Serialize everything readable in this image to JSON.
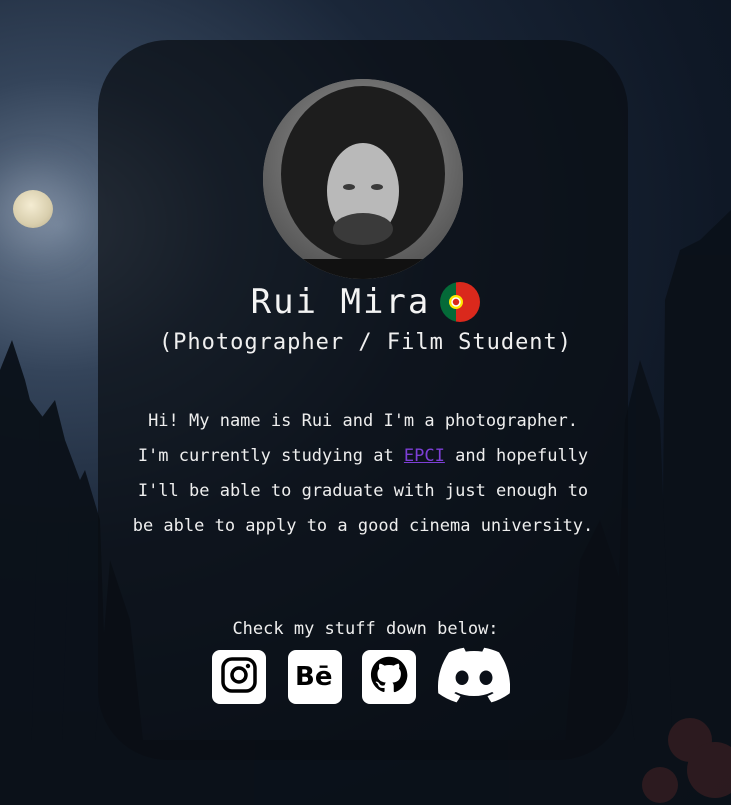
{
  "profile": {
    "name": "Rui Mira",
    "subtitle": "(Photographer / Film Student)",
    "avatar_alt": "Rui Mira portrait",
    "flag": "portugal-flag-icon"
  },
  "bio": {
    "part1": "Hi! My name is Rui and I'm a photographer. I'm currently studying at ",
    "link_text": "EPCI",
    "part2": " and hopefully I'll be able to graduate with just enough to be able to apply to a good cinema university."
  },
  "socials": {
    "heading": "Check my stuff down below:",
    "links": [
      {
        "name": "Instagram",
        "icon": "instagram-icon"
      },
      {
        "name": "Behance",
        "icon": "behance-icon"
      },
      {
        "name": "GitHub",
        "icon": "github-icon"
      },
      {
        "name": "Discord",
        "icon": "discord-icon"
      }
    ]
  },
  "colors": {
    "link": "#7d3fd6",
    "text": "#f0f0f0",
    "card": "rgba(10,14,20,0.72)"
  }
}
